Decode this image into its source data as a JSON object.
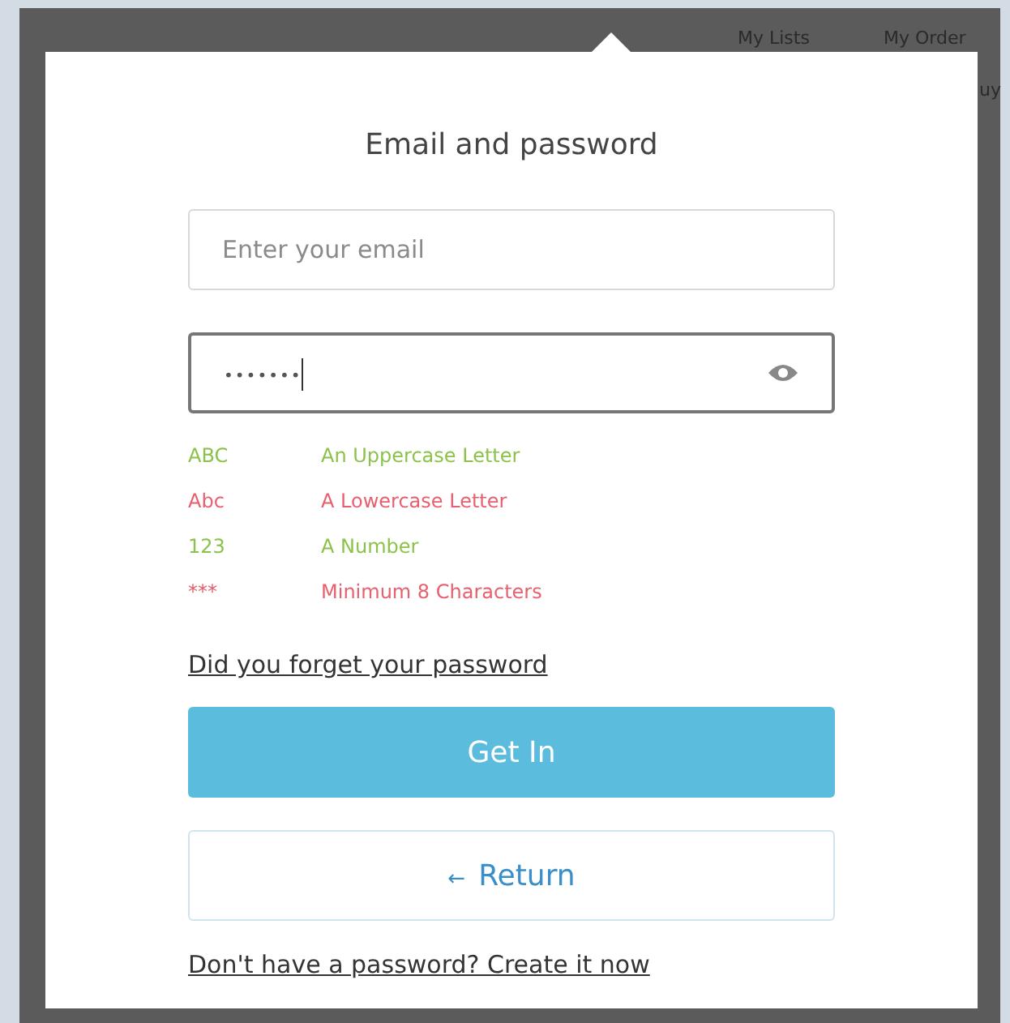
{
  "header_links": [
    "My Lists",
    "My Order",
    "uy"
  ],
  "dialog": {
    "title": "Email and password",
    "email": {
      "placeholder": "Enter your email"
    },
    "password": {
      "value": "•••••••",
      "focused": true
    },
    "rules": [
      {
        "sample": "ABC",
        "label": "An Uppercase Letter",
        "met": true
      },
      {
        "sample": "Abc",
        "label": "A Lowercase Letter",
        "met": false
      },
      {
        "sample": "123",
        "label": "A Number",
        "met": true
      },
      {
        "sample": "***",
        "label": "Minimum 8 Characters",
        "met": false
      }
    ],
    "forgot_link": "Did you forget your password",
    "submit": "Get In",
    "return_arrow": "←",
    "return": "Return",
    "create_link": "Don't have a password? Create it now"
  }
}
